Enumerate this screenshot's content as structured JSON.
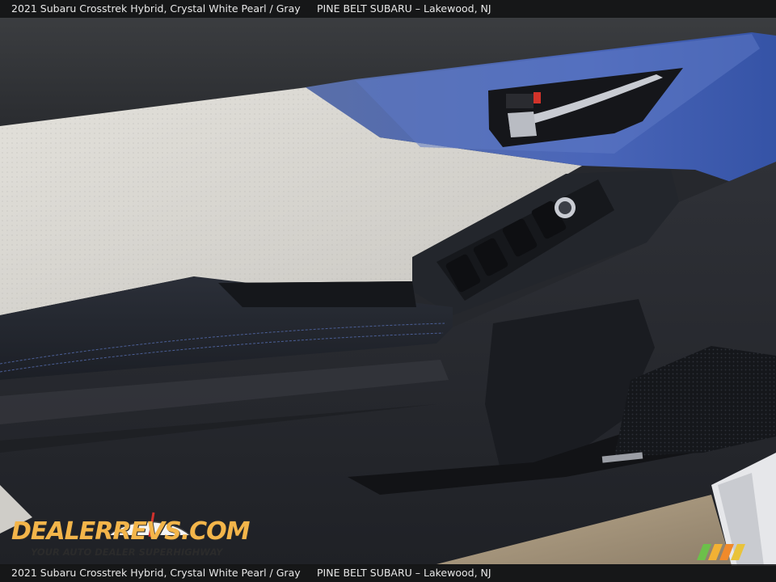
{
  "caption": {
    "vehicle": "2021 Subaru Crosstrek Hybrid,  Crystal White Pearl / Gray",
    "dealer": "PINE BELT SUBARU – Lakewood, NJ"
  },
  "watermark": {
    "brand": "DEALERREVS.COM",
    "tagline": "YOUR AUTO DEALER SUPERHIGHWAY"
  },
  "colors": {
    "panel_dark": "#22252c",
    "leather_light": "#d9d7d2",
    "trim_blue": "#4a67b8",
    "caption_bg": "#141416"
  }
}
